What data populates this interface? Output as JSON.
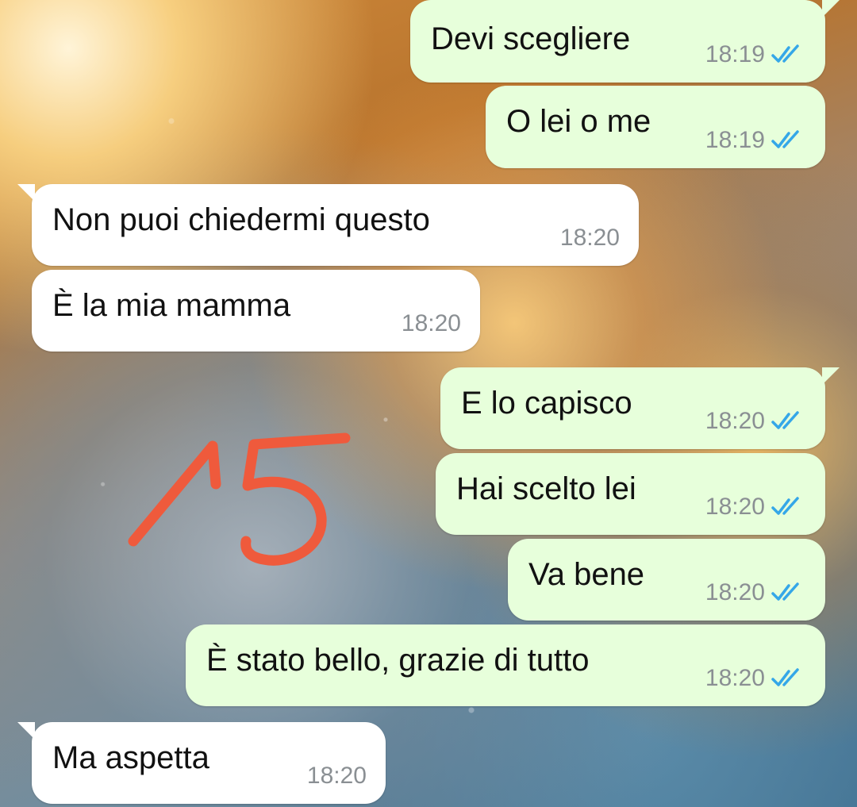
{
  "colors": {
    "outgoing_bubble": "#e7ffdb",
    "incoming_bubble": "#ffffff",
    "timestamp": "#8a8f93",
    "read_ticks": "#35a7e8",
    "annotation": "#ef5a3c"
  },
  "messages": [
    {
      "direction": "outgoing",
      "text": "Devi scegliere",
      "time": "18:19",
      "status": "read-double-check-icon"
    },
    {
      "direction": "outgoing",
      "text": "O lei o me",
      "time": "18:19",
      "status": "read-double-check-icon"
    },
    {
      "direction": "incoming",
      "text": "Non puoi chiedermi questo",
      "time": "18:20"
    },
    {
      "direction": "incoming",
      "text": "È la mia mamma",
      "time": "18:20"
    },
    {
      "direction": "outgoing",
      "text": "E lo capisco",
      "time": "18:20",
      "status": "read-double-check-icon"
    },
    {
      "direction": "outgoing",
      "text": "Hai scelto lei",
      "time": "18:20",
      "status": "read-double-check-icon"
    },
    {
      "direction": "outgoing",
      "text": "Va bene",
      "time": "18:20",
      "status": "read-double-check-icon"
    },
    {
      "direction": "outgoing",
      "text": "È stato bello, grazie di tutto",
      "time": "18:20",
      "status": "read-double-check-icon"
    },
    {
      "direction": "incoming",
      "text": "Ma aspetta",
      "time": "18:20"
    }
  ],
  "annotation": {
    "text": "15"
  }
}
